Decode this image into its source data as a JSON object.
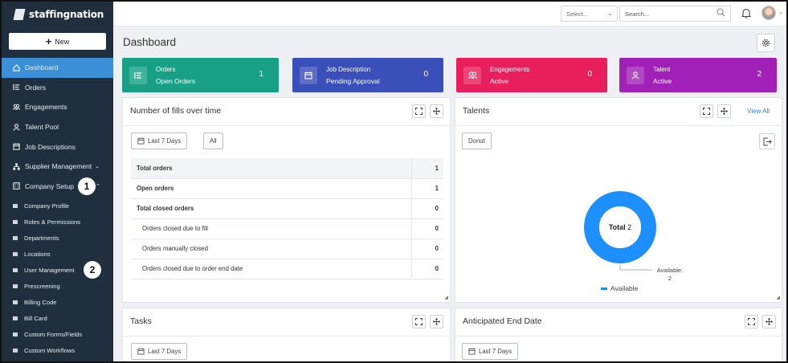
{
  "app": {
    "brand": "staffingnation"
  },
  "sidebar": {
    "new_label": "New",
    "items": [
      {
        "label": "Dashboard",
        "icon": "home-icon"
      },
      {
        "label": "Orders",
        "icon": "orders-icon"
      },
      {
        "label": "Engagements",
        "icon": "engagements-icon"
      },
      {
        "label": "Talent Pool",
        "icon": "person-icon"
      },
      {
        "label": "Job Descriptions",
        "icon": "calendar-icon"
      },
      {
        "label": "Supplier Management",
        "icon": "org-chart-icon"
      },
      {
        "label": "Company Setup",
        "icon": "building-icon"
      }
    ],
    "sub_items": [
      "Company Profile",
      "Roles & Permissions",
      "Departments",
      "Locations",
      "User Management",
      "Prescreening",
      "Billing Code",
      "Bill Card",
      "Custom Forms/Fields",
      "Custom Workflows"
    ],
    "callouts": {
      "one": "1",
      "two": "2"
    }
  },
  "topbar": {
    "select_placeholder": "Select...",
    "search_placeholder": "Search..."
  },
  "page": {
    "title": "Dashboard"
  },
  "kpis": [
    {
      "line1": "Orders",
      "line2": "Open Orders",
      "value": "1",
      "color": "#17a086"
    },
    {
      "line1": "Job Description",
      "line2": "Pending Approval",
      "value": "0",
      "color": "#3b4fba"
    },
    {
      "line1": "Engagements",
      "line2": "Active",
      "value": "0",
      "color": "#e91e5c"
    },
    {
      "line1": "Talent",
      "line2": "Active",
      "value": "2",
      "color": "#a020b8"
    }
  ],
  "fills_card": {
    "title": "Number of fills over time",
    "range_label": "Last 7 Days",
    "all_label": "All",
    "rows": [
      {
        "label": "Total orders",
        "value": "1"
      },
      {
        "label": "Open orders",
        "value": "1"
      },
      {
        "label": "Total closed orders",
        "value": "0"
      },
      {
        "label": "Orders closed due to fill",
        "value": "0"
      },
      {
        "label": "Orders manually closed",
        "value": "0"
      },
      {
        "label": "Orders closed due to order end date",
        "value": "0"
      }
    ]
  },
  "talents_card": {
    "title": "Talents",
    "view_all": "View All",
    "chart_type_label": "Donut",
    "center_label": "Total",
    "center_value": "2",
    "callout_label": "Available:",
    "callout_value": "2",
    "legend": "Available",
    "accent": "#1e8fff"
  },
  "chart_data": {
    "type": "pie",
    "categories": [
      "Available"
    ],
    "values": [
      2
    ],
    "title": "",
    "legend_position": "bottom"
  },
  "tasks_card": {
    "title": "Tasks",
    "range_label": "Last 7 Days"
  },
  "end_date_card": {
    "title": "Anticipated End Date",
    "range_label": "Last 7 Days"
  }
}
